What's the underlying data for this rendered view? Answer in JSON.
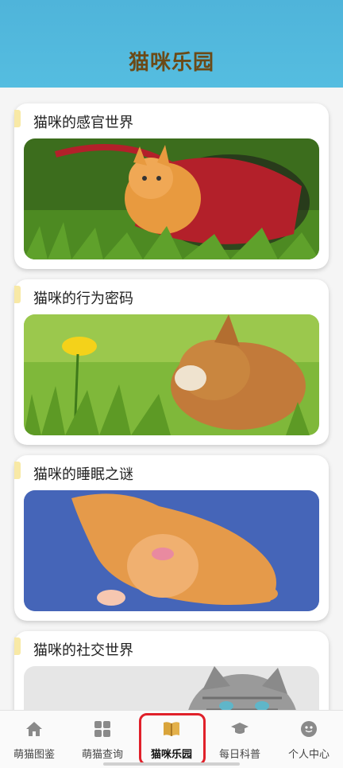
{
  "header": {
    "title": "猫咪乐园"
  },
  "cards": [
    {
      "title": "猫咪的感官世界"
    },
    {
      "title": "猫咪的行为密码"
    },
    {
      "title": "猫咪的睡眠之谜"
    },
    {
      "title": "猫咪的社交世界"
    }
  ],
  "tabbar": {
    "items": [
      {
        "label": "萌猫图鉴",
        "icon": "home-icon"
      },
      {
        "label": "萌猫查询",
        "icon": "grid-icon"
      },
      {
        "label": "猫咪乐园",
        "icon": "book-icon",
        "active": true
      },
      {
        "label": "每日科普",
        "icon": "graduation-cap-icon"
      },
      {
        "label": "个人中心",
        "icon": "face-icon"
      }
    ]
  },
  "colors": {
    "header_bg": "#55bde0",
    "header_title": "#6b4a17",
    "card_accent": "#f8e9a6",
    "active_tab_icon": "#d9a43a",
    "highlight_border": "#e0202a"
  }
}
